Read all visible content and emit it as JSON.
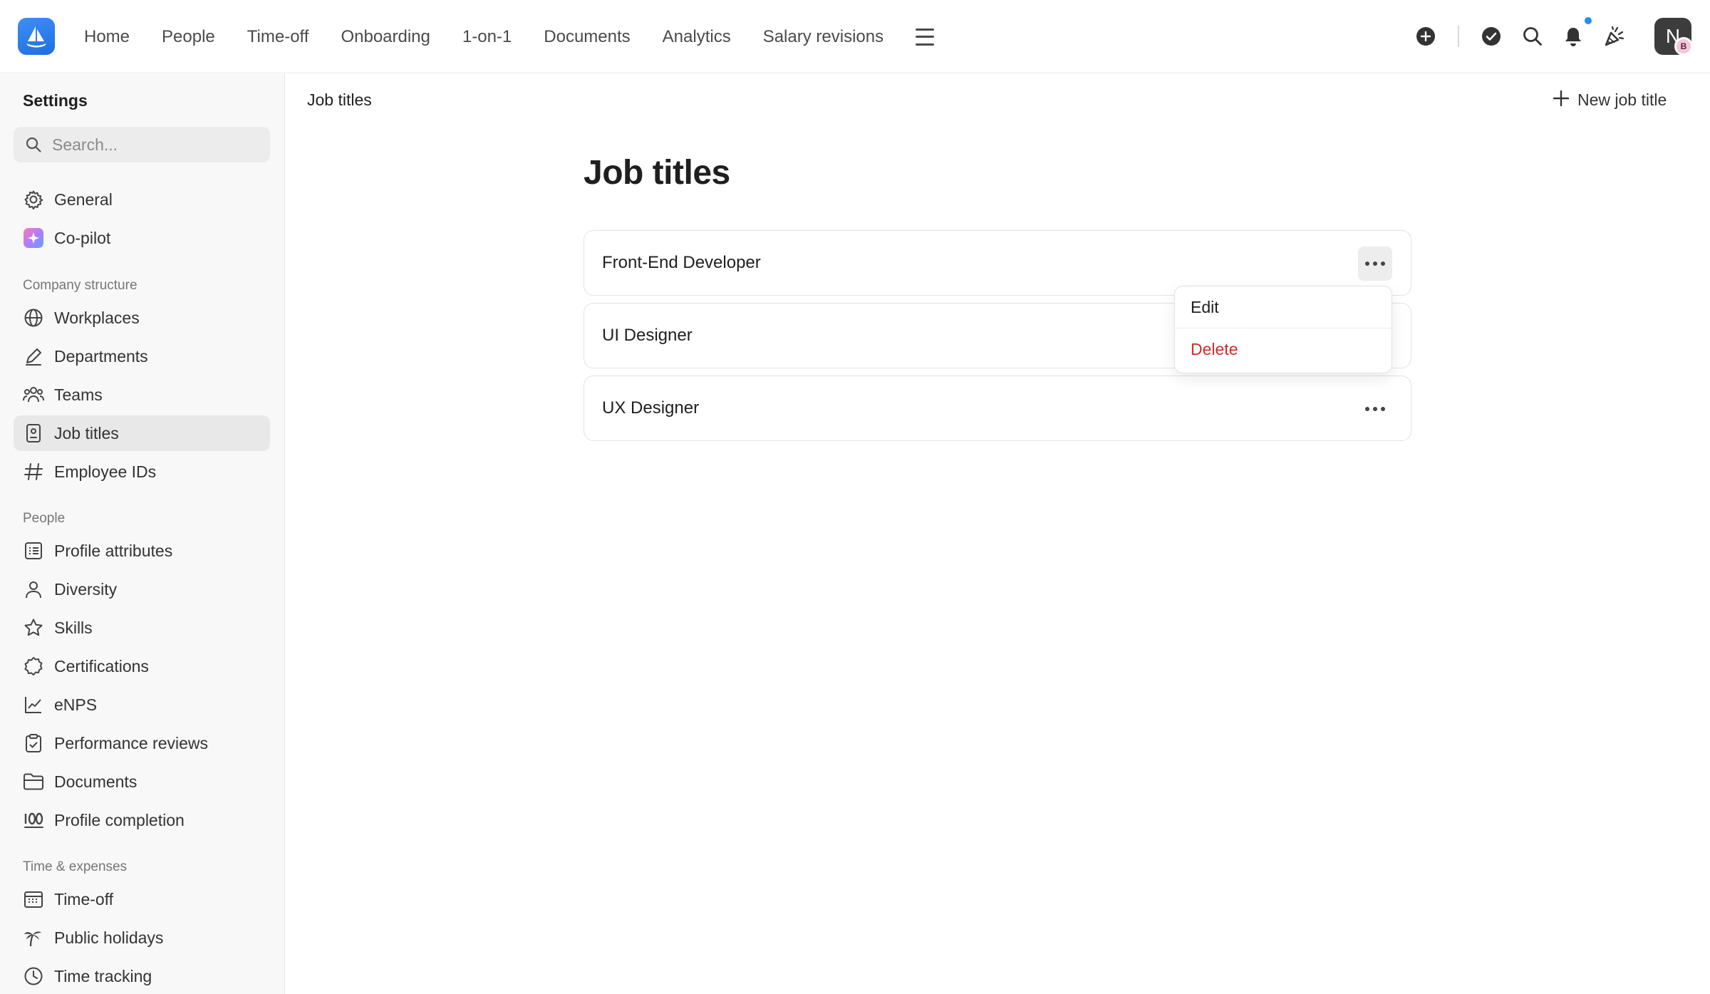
{
  "nav": {
    "items": [
      "Home",
      "People",
      "Time-off",
      "Onboarding",
      "1-on-1",
      "Documents",
      "Analytics",
      "Salary revisions"
    ]
  },
  "user": {
    "initial": "N",
    "badge": "B"
  },
  "sidebar": {
    "title": "Settings",
    "search_placeholder": "Search...",
    "top_items": [
      {
        "label": "General",
        "icon": "gear-icon"
      },
      {
        "label": "Co-pilot",
        "icon": "sparkle-icon"
      }
    ],
    "sections": [
      {
        "title": "Company structure",
        "items": [
          {
            "label": "Workplaces",
            "icon": "globe-icon"
          },
          {
            "label": "Departments",
            "icon": "pen-icon"
          },
          {
            "label": "Teams",
            "icon": "people-icon"
          },
          {
            "label": "Job titles",
            "icon": "badge-icon",
            "active": true
          },
          {
            "label": "Employee IDs",
            "icon": "hash-icon"
          }
        ]
      },
      {
        "title": "People",
        "items": [
          {
            "label": "Profile attributes",
            "icon": "list-icon"
          },
          {
            "label": "Diversity",
            "icon": "person-icon"
          },
          {
            "label": "Skills",
            "icon": "star-icon"
          },
          {
            "label": "Certifications",
            "icon": "seal-icon"
          },
          {
            "label": "eNPS",
            "icon": "chart-line-icon"
          },
          {
            "label": "Performance reviews",
            "icon": "clipboard-check-icon"
          },
          {
            "label": "Documents",
            "icon": "folder-icon"
          },
          {
            "label": "Profile completion",
            "icon": "hundred-icon"
          }
        ]
      },
      {
        "title": "Time & expenses",
        "items": [
          {
            "label": "Time-off",
            "icon": "calendar-icon"
          },
          {
            "label": "Public holidays",
            "icon": "palm-icon"
          },
          {
            "label": "Time tracking",
            "icon": "clock-icon"
          }
        ]
      }
    ]
  },
  "main": {
    "breadcrumb": "Job titles",
    "new_button": "New job title",
    "title": "Job titles",
    "rows": [
      "Front-End Developer",
      "UI Designer",
      "UX Designer"
    ],
    "menu": {
      "edit": "Edit",
      "delete": "Delete"
    }
  }
}
